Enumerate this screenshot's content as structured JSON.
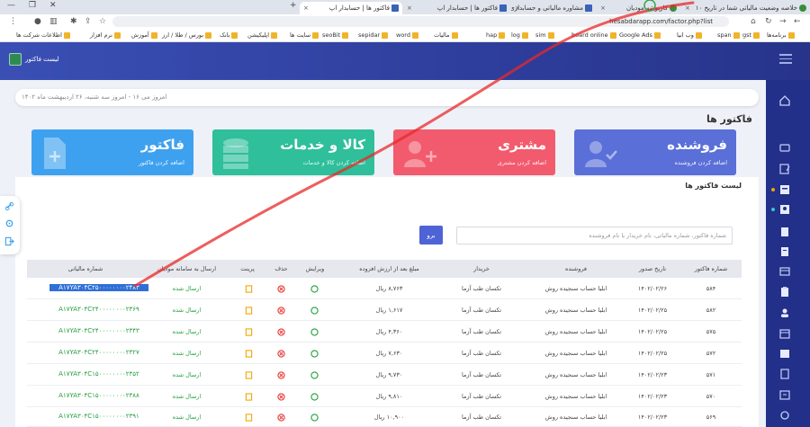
{
  "browser": {
    "tabs": [
      {
        "label": "خلاصه وضعیت مالیاتی شما در تاریخ ۱۰",
        "favicon": "green"
      },
      {
        "label": "کارپوشه مودیان",
        "favicon": "green"
      },
      {
        "label": "مشاوره مالیاتی و حسابداری",
        "favicon": "blue"
      },
      {
        "label": "فاکتور ها | حسابدار اپ",
        "favicon": "blue"
      },
      {
        "label": "فاکتور ها | حسابدار اپ",
        "favicon": "blue",
        "active": true
      }
    ],
    "url": "hesabdarapp.com/factor.php?list",
    "bookmarks": [
      "برنامه‌ها",
      "gst",
      "span",
      "وب انیا",
      "Google Ads",
      "board online",
      "sim",
      "log",
      "hap",
      "مالیات",
      "word",
      "sepidar",
      "seoBit",
      "سایت ها",
      "اپلیکیشن",
      "بانک",
      "بورس / طلا / ارز",
      "آموزش",
      "نرم افزار",
      "اطلاعات شرکت ها"
    ]
  },
  "header": {
    "brand": "لیست فاکتور"
  },
  "date_text": "امروز سه شنبه، ۲۶ اردیبهشت ماه ۱۴۰۲",
  "date_prefix": "امروز می ۱۶ -",
  "page_title": "فاکتور ها",
  "cards": [
    {
      "title": "فروشنده",
      "subtitle": "اضافه کردن فروشنده",
      "color": "#5a6fd8"
    },
    {
      "title": "مشتری",
      "subtitle": "اضافه کردن مشتری",
      "color": "#f25b6d"
    },
    {
      "title": "کالا و خدمات",
      "subtitle": "اضافه کردن کالا و خدمات",
      "color": "#2fbf9b"
    },
    {
      "title": "فاکتور",
      "subtitle": "اضافه کردن فاکتور",
      "color": "#3ea1ef"
    }
  ],
  "list_title": "لیست فاکتور ها",
  "search": {
    "placeholder": "شماره فاکتور، شماره مالیاتی، نام خریدار یا نام فروشنده",
    "button": "برو"
  },
  "table": {
    "headers": [
      "شماره فاکتور",
      "تاریخ صدور",
      "فروشنده",
      "خریدار",
      "مبلغ بعد از ارزش افزوده",
      "ویرایش",
      "حذف",
      "پرینت",
      "ارسال به سامانه مودیان",
      "شماره مالیاتی"
    ],
    "rows": [
      {
        "num": "۵۸۴",
        "date": "۱۴۰۲/۰۲/۲۶",
        "seller": "ابلیا حساب سنجیده روش",
        "buyer": "تکسان طب آزما",
        "amount": "۸,۷۶۳ ریال",
        "status": "ارسال شده",
        "tax": "A۱۷YA۳۰۴C۲۵۰۰۰۰۰۰۰۰۲۴۸۳",
        "selected": true
      },
      {
        "num": "۵۸۲",
        "date": "۱۴۰۲/۰۲/۲۵",
        "seller": "ابلیا حساب سنجیده روش",
        "buyer": "تکسان طب آزما",
        "amount": "۱,۶۱۷ ریال",
        "status": "ارسال شده",
        "tax": "A۱۷YA۳۰۴C۲۴۰۰۰۰۰۰۰۰۲۳۶۹"
      },
      {
        "num": "۵۷۵",
        "date": "۱۴۰۲/۰۲/۲۵",
        "seller": "ابلیا حساب سنجیده روش",
        "buyer": "تکسان طب آزما",
        "amount": "۴,۳۶۰ ریال",
        "status": "ارسال شده",
        "tax": "A۱۷YA۳۰۴C۲۴۰۰۰۰۰۰۰۰۲۳۴۳"
      },
      {
        "num": "۵۷۲",
        "date": "۱۴۰۲/۰۲/۲۵",
        "seller": "ابلیا حساب سنجیده روش",
        "buyer": "تکسان طب آزما",
        "amount": "۷,۶۳۰ ریال",
        "status": "ارسال شده",
        "tax": "A۱۷YA۳۰۴C۲۴۰۰۰۰۰۰۰۰۲۳۲۷"
      },
      {
        "num": "۵۷۱",
        "date": "۱۴۰۲/۰۲/۲۳",
        "seller": "ابلیا حساب سنجیده روش",
        "buyer": "تکسان طب آزما",
        "amount": "۹,۷۳۰ ریال",
        "status": "ارسال شده",
        "tax": "A۱۷YA۳۰۴C۱۵۰۰۰۰۰۰۰۰۲۳۵۲"
      },
      {
        "num": "۵۷۰",
        "date": "۱۴۰۲/۰۲/۲۳",
        "seller": "ابلیا حساب سنجیده روش",
        "buyer": "تکسان طب آزما",
        "amount": "۹,۸۱۰ ریال",
        "status": "ارسال شده",
        "tax": "A۱۷YA۳۰۴C۱۵۰۰۰۰۰۰۰۰۲۳۸۸"
      },
      {
        "num": "۵۶۹",
        "date": "۱۴۰۲/۰۲/۲۳",
        "seller": "ابلیا حساب سنجیده روش",
        "buyer": "تکسان طب آزما",
        "amount": "۱۰,۹۰۰ ریال",
        "status": "ارسال شده",
        "tax": "A۱۷YA۳۰۴C۱۵۰۰۰۰۰۰۰۰۲۳۹۱"
      }
    ]
  },
  "colors": {
    "header": "#2f3f9e",
    "sidebar": "#22308a",
    "green": "#1f9d3a",
    "delete": "#e53935",
    "print": "#f0a500",
    "button": "#4e63d6"
  }
}
